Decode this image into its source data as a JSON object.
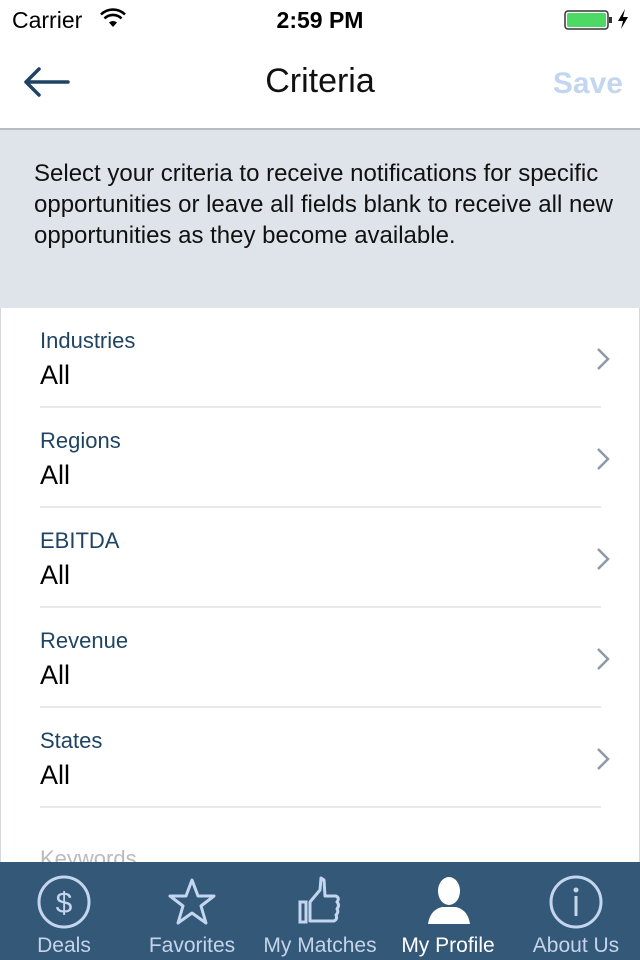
{
  "status_bar": {
    "carrier": "Carrier",
    "time": "2:59 PM",
    "battery_color": "#4cd964"
  },
  "navbar": {
    "back_icon": "arrow-left-icon",
    "title": "Criteria",
    "save_label": "Save"
  },
  "intro": {
    "text": "Select your criteria to receive notifications for specific opportunities or leave all fields blank to receive all new opportunities as they become available."
  },
  "criteria": [
    {
      "label": "Industries",
      "value": "All"
    },
    {
      "label": "Regions",
      "value": "All"
    },
    {
      "label": "EBITDA",
      "value": "All"
    },
    {
      "label": "Revenue",
      "value": "All"
    },
    {
      "label": "States",
      "value": "All"
    }
  ],
  "keywords_label": "Keywords",
  "tabbar": {
    "background": "#345878",
    "items": [
      {
        "label": "Deals",
        "icon": "dollar-circle-icon"
      },
      {
        "label": "Favorites",
        "icon": "star-icon"
      },
      {
        "label": "My Matches",
        "icon": "thumbs-up-icon"
      },
      {
        "label": "My Profile",
        "icon": "user-icon",
        "active": true
      },
      {
        "label": "About Us",
        "icon": "info-circle-icon"
      }
    ]
  }
}
